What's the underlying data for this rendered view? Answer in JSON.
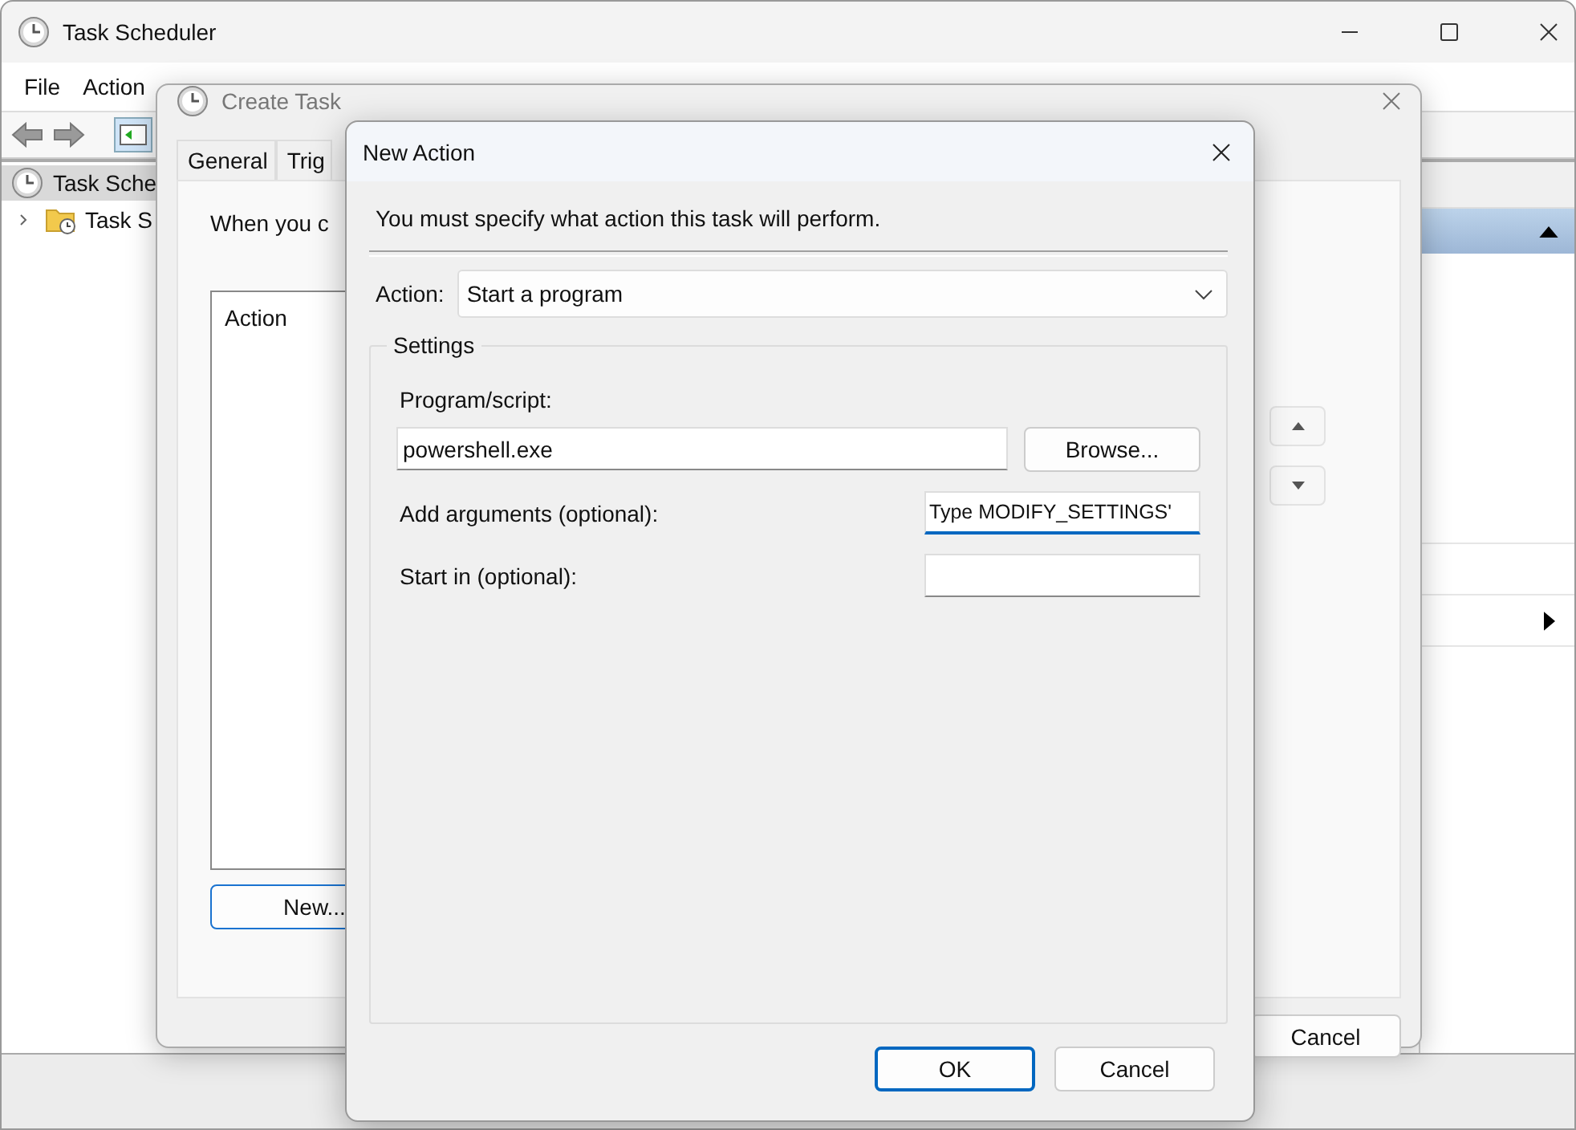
{
  "main_window": {
    "title": "Task Scheduler",
    "menu": [
      "File",
      "Action"
    ],
    "tree": [
      {
        "label": "Task Sche",
        "selected": true,
        "children": [
          {
            "label": "Task S",
            "expanded": false
          }
        ]
      }
    ]
  },
  "create_task": {
    "title": "Create Task",
    "tabs": [
      {
        "label": "General",
        "selected": false
      },
      {
        "label": "Trig",
        "selected": false
      }
    ],
    "intro": "When you c",
    "list_header": "Action",
    "new_button": "New...",
    "cancel_button": "Cancel"
  },
  "new_action": {
    "title": "New Action",
    "message": "You must specify what action this task will perform.",
    "action_label": "Action:",
    "action_value": "Start a program",
    "group": "Settings",
    "program_label": "Program/script:",
    "program_value": "powershell.exe",
    "browse_button": "Browse...",
    "args_label": "Add arguments (optional):",
    "args_value": "Type MODIFY_SETTINGS'",
    "start_label": "Start in (optional):",
    "buttons": [
      {
        "label": "OK",
        "default": true
      },
      {
        "label": "Cancel",
        "default": false
      }
    ]
  }
}
